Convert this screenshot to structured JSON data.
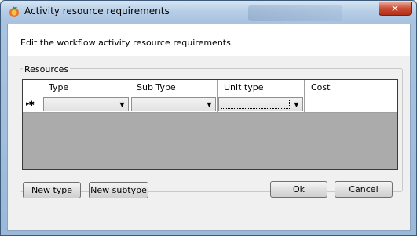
{
  "window": {
    "title": "Activity resource requirements",
    "close_label": "✕"
  },
  "header": {
    "instruction": "Edit the workflow activity resource requirements"
  },
  "resources": {
    "group_label": "Resources",
    "columns": [
      "Type",
      "Sub Type",
      "Unit type",
      "Cost"
    ],
    "new_row_indicator": "▸✱",
    "new_row": {
      "type": "",
      "sub_type": "",
      "unit_type": "",
      "cost": ""
    }
  },
  "buttons": {
    "new_type": "New type",
    "new_subtype": "New subtype",
    "ok": "Ok",
    "cancel": "Cancel"
  },
  "icons": {
    "app": "app-icon",
    "dropdown": "chevron-down-icon"
  },
  "colors": {
    "grid_background": "#ababab",
    "close_button": "#c94a31"
  }
}
